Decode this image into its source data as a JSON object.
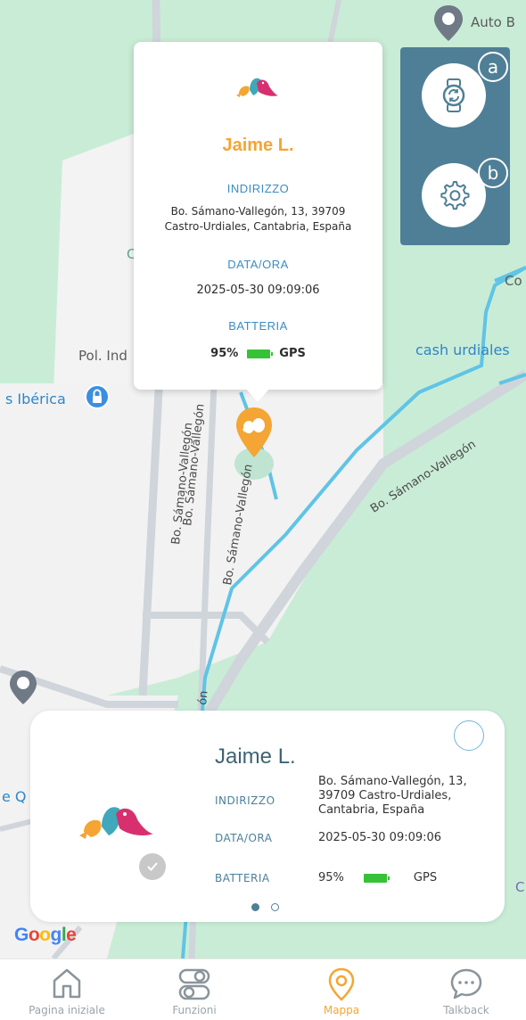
{
  "map": {
    "labels": {
      "auto": "Auto B",
      "pol_ind": "Pol. Ind",
      "iberica": "s Ibérica",
      "cash": "cash urdiales",
      "co": "Co",
      "road_a": "Bo. Sámano-Vallegón",
      "road_b": "Bo. Sámano-Vallegón",
      "road_c": "Bo. Sámano-Vallegón",
      "road_d": "ón",
      "eq": "e Q",
      "c_right": "C",
      "c_left": "C"
    },
    "google_logo": "Google"
  },
  "controls": {
    "watch_button_badge": "a",
    "settings_button_badge": "b",
    "watch_icon": "watch-sync-icon",
    "settings_icon": "gear-icon"
  },
  "popup": {
    "name": "Jaime L.",
    "address_label": "INDIRIZZO",
    "address_line1": "Bo. Sámano-Vallegón, 13, 39709",
    "address_line2": "Castro-Urdiales, Cantabria, España",
    "datetime_label": "DATA/ORA",
    "datetime": "2025-05-30 09:09:06",
    "battery_label": "BATTERIA",
    "battery_value": "95%",
    "source": "GPS"
  },
  "card": {
    "name": "Jaime L.",
    "address_label": "INDIRIZZO",
    "address_line1": "Bo. Sámano-Vallegón, 13,",
    "address_line2": "39709 Castro-Urdiales,",
    "address_line3": "Cantabria, España",
    "datetime_label": "DATA/ORA",
    "datetime": "2025-05-30 09:09:06",
    "battery_label": "BATTERIA",
    "battery_value": "95%",
    "source": "GPS",
    "page_count": 2,
    "active_page": 1
  },
  "nav": {
    "items": [
      {
        "label": "Pagina iniziale",
        "icon": "home-icon"
      },
      {
        "label": "Funzioni",
        "icon": "functions-icon"
      },
      {
        "label": "Mappa",
        "icon": "map-pin-icon"
      },
      {
        "label": "Talkback",
        "icon": "chat-icon"
      }
    ],
    "active": "Mappa"
  },
  "colors": {
    "accent_orange": "#f4a534",
    "panel_blue": "#4f7f96",
    "label_blue": "#3b8cc4",
    "battery_green": "#36c236",
    "map_green": "#c9ecd6"
  }
}
